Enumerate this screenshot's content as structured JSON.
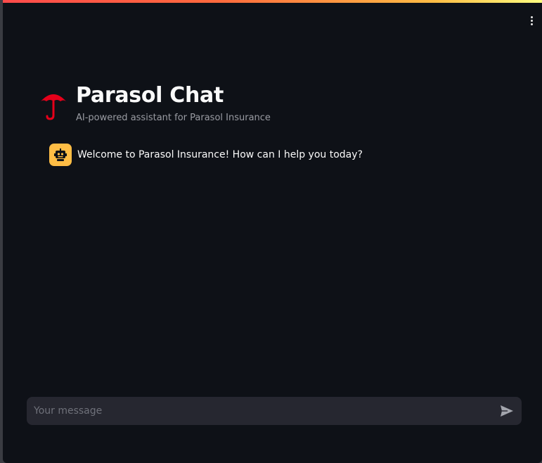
{
  "header": {
    "title": "Parasol Chat",
    "subtitle": "AI-powered assistant for Parasol Insurance",
    "logo_icon": "umbrella-icon"
  },
  "chat": {
    "messages": [
      {
        "role": "assistant",
        "avatar_icon": "robot-icon",
        "text": "Welcome to Parasol Insurance! How can I help you today?"
      }
    ]
  },
  "input": {
    "placeholder": "Your message",
    "value": "",
    "send_icon": "send-icon"
  },
  "toolbar": {
    "menu_icon": "kebab-menu-icon"
  },
  "colors": {
    "background": "#0e1117",
    "accent_red": "#e5001a",
    "avatar_yellow": "#ffbd45",
    "input_background": "#262730"
  }
}
